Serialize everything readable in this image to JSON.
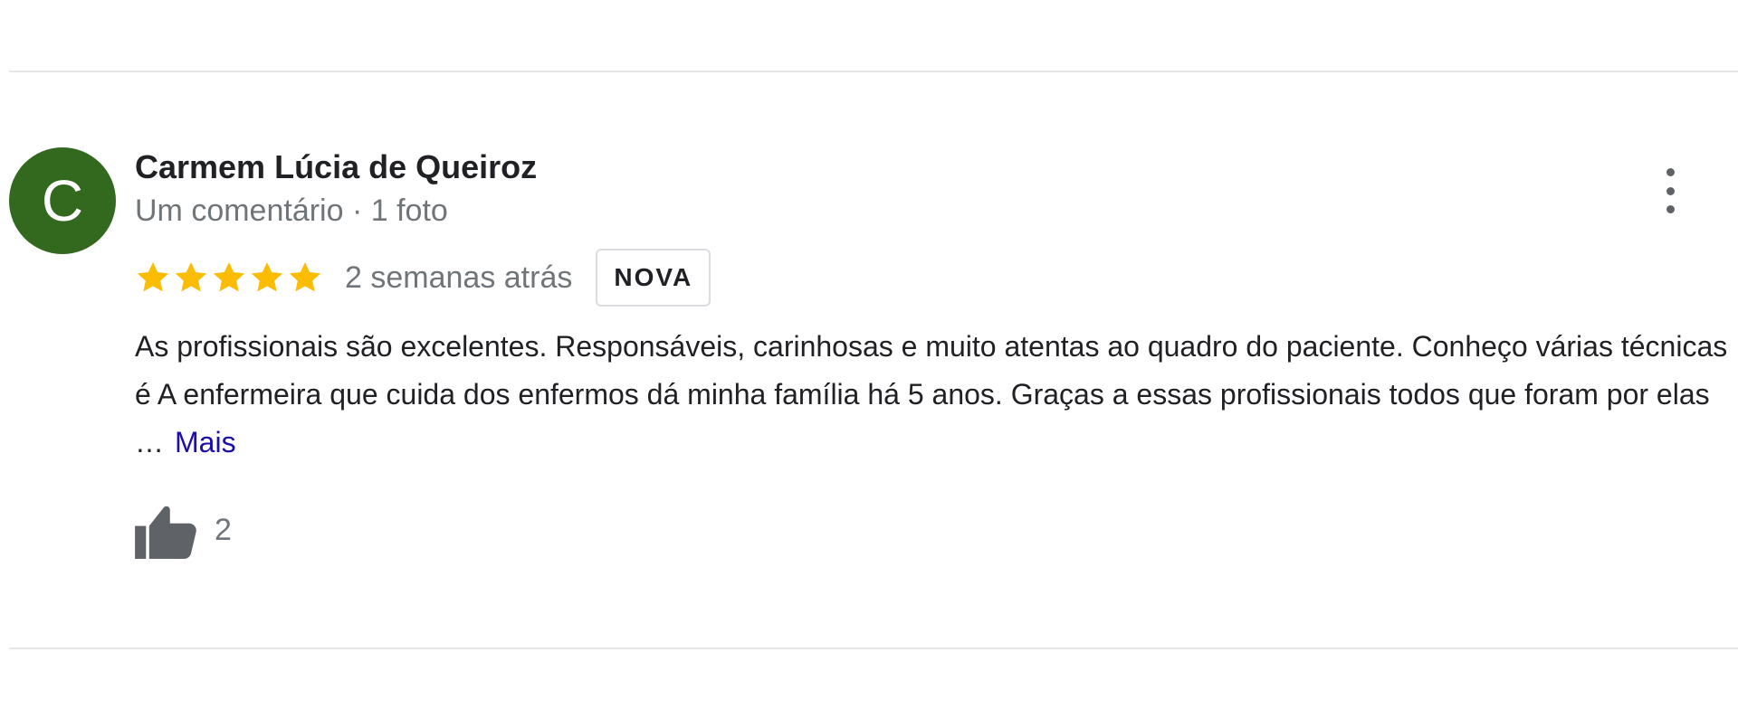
{
  "review": {
    "avatar_letter": "C",
    "avatar_color": "#33691e",
    "author_name": "Carmem Lúcia de Queiroz",
    "author_meta": "Um comentário · 1 foto",
    "rating": 5,
    "rating_max": 5,
    "star_color": "#fbbc04",
    "time": "2 semanas atrás",
    "badge": "NOVA",
    "text": "As profissionais são excelentes. Responsáveis, carinhosas e muito atentas ao quadro do paciente. Conheço várias técnicas é A enfermeira que cuida dos enfermos dá minha família há 5 anos. Graças a essas profissionais todos que foram por elas …",
    "more_label": "Mais",
    "like_icon": "thumbs-up-icon",
    "like_count": "2",
    "menu_icon": "more-vert-icon"
  }
}
